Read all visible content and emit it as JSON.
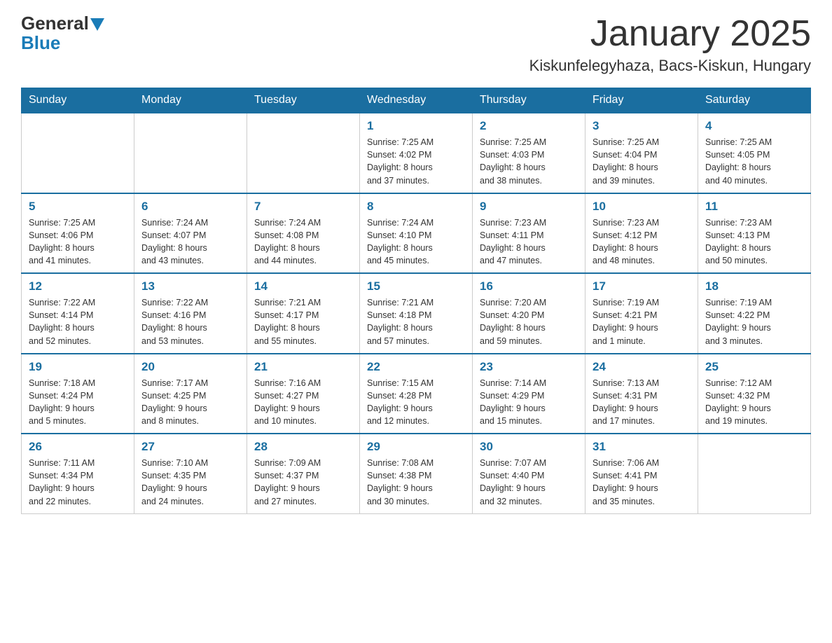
{
  "header": {
    "logo_general": "General",
    "logo_blue": "Blue",
    "month_title": "January 2025",
    "location": "Kiskunfelegyhaza, Bacs-Kiskun, Hungary"
  },
  "weekdays": [
    "Sunday",
    "Monday",
    "Tuesday",
    "Wednesday",
    "Thursday",
    "Friday",
    "Saturday"
  ],
  "weeks": [
    {
      "days": [
        {
          "num": "",
          "info": ""
        },
        {
          "num": "",
          "info": ""
        },
        {
          "num": "",
          "info": ""
        },
        {
          "num": "1",
          "info": "Sunrise: 7:25 AM\nSunset: 4:02 PM\nDaylight: 8 hours\nand 37 minutes."
        },
        {
          "num": "2",
          "info": "Sunrise: 7:25 AM\nSunset: 4:03 PM\nDaylight: 8 hours\nand 38 minutes."
        },
        {
          "num": "3",
          "info": "Sunrise: 7:25 AM\nSunset: 4:04 PM\nDaylight: 8 hours\nand 39 minutes."
        },
        {
          "num": "4",
          "info": "Sunrise: 7:25 AM\nSunset: 4:05 PM\nDaylight: 8 hours\nand 40 minutes."
        }
      ]
    },
    {
      "days": [
        {
          "num": "5",
          "info": "Sunrise: 7:25 AM\nSunset: 4:06 PM\nDaylight: 8 hours\nand 41 minutes."
        },
        {
          "num": "6",
          "info": "Sunrise: 7:24 AM\nSunset: 4:07 PM\nDaylight: 8 hours\nand 43 minutes."
        },
        {
          "num": "7",
          "info": "Sunrise: 7:24 AM\nSunset: 4:08 PM\nDaylight: 8 hours\nand 44 minutes."
        },
        {
          "num": "8",
          "info": "Sunrise: 7:24 AM\nSunset: 4:10 PM\nDaylight: 8 hours\nand 45 minutes."
        },
        {
          "num": "9",
          "info": "Sunrise: 7:23 AM\nSunset: 4:11 PM\nDaylight: 8 hours\nand 47 minutes."
        },
        {
          "num": "10",
          "info": "Sunrise: 7:23 AM\nSunset: 4:12 PM\nDaylight: 8 hours\nand 48 minutes."
        },
        {
          "num": "11",
          "info": "Sunrise: 7:23 AM\nSunset: 4:13 PM\nDaylight: 8 hours\nand 50 minutes."
        }
      ]
    },
    {
      "days": [
        {
          "num": "12",
          "info": "Sunrise: 7:22 AM\nSunset: 4:14 PM\nDaylight: 8 hours\nand 52 minutes."
        },
        {
          "num": "13",
          "info": "Sunrise: 7:22 AM\nSunset: 4:16 PM\nDaylight: 8 hours\nand 53 minutes."
        },
        {
          "num": "14",
          "info": "Sunrise: 7:21 AM\nSunset: 4:17 PM\nDaylight: 8 hours\nand 55 minutes."
        },
        {
          "num": "15",
          "info": "Sunrise: 7:21 AM\nSunset: 4:18 PM\nDaylight: 8 hours\nand 57 minutes."
        },
        {
          "num": "16",
          "info": "Sunrise: 7:20 AM\nSunset: 4:20 PM\nDaylight: 8 hours\nand 59 minutes."
        },
        {
          "num": "17",
          "info": "Sunrise: 7:19 AM\nSunset: 4:21 PM\nDaylight: 9 hours\nand 1 minute."
        },
        {
          "num": "18",
          "info": "Sunrise: 7:19 AM\nSunset: 4:22 PM\nDaylight: 9 hours\nand 3 minutes."
        }
      ]
    },
    {
      "days": [
        {
          "num": "19",
          "info": "Sunrise: 7:18 AM\nSunset: 4:24 PM\nDaylight: 9 hours\nand 5 minutes."
        },
        {
          "num": "20",
          "info": "Sunrise: 7:17 AM\nSunset: 4:25 PM\nDaylight: 9 hours\nand 8 minutes."
        },
        {
          "num": "21",
          "info": "Sunrise: 7:16 AM\nSunset: 4:27 PM\nDaylight: 9 hours\nand 10 minutes."
        },
        {
          "num": "22",
          "info": "Sunrise: 7:15 AM\nSunset: 4:28 PM\nDaylight: 9 hours\nand 12 minutes."
        },
        {
          "num": "23",
          "info": "Sunrise: 7:14 AM\nSunset: 4:29 PM\nDaylight: 9 hours\nand 15 minutes."
        },
        {
          "num": "24",
          "info": "Sunrise: 7:13 AM\nSunset: 4:31 PM\nDaylight: 9 hours\nand 17 minutes."
        },
        {
          "num": "25",
          "info": "Sunrise: 7:12 AM\nSunset: 4:32 PM\nDaylight: 9 hours\nand 19 minutes."
        }
      ]
    },
    {
      "days": [
        {
          "num": "26",
          "info": "Sunrise: 7:11 AM\nSunset: 4:34 PM\nDaylight: 9 hours\nand 22 minutes."
        },
        {
          "num": "27",
          "info": "Sunrise: 7:10 AM\nSunset: 4:35 PM\nDaylight: 9 hours\nand 24 minutes."
        },
        {
          "num": "28",
          "info": "Sunrise: 7:09 AM\nSunset: 4:37 PM\nDaylight: 9 hours\nand 27 minutes."
        },
        {
          "num": "29",
          "info": "Sunrise: 7:08 AM\nSunset: 4:38 PM\nDaylight: 9 hours\nand 30 minutes."
        },
        {
          "num": "30",
          "info": "Sunrise: 7:07 AM\nSunset: 4:40 PM\nDaylight: 9 hours\nand 32 minutes."
        },
        {
          "num": "31",
          "info": "Sunrise: 7:06 AM\nSunset: 4:41 PM\nDaylight: 9 hours\nand 35 minutes."
        },
        {
          "num": "",
          "info": ""
        }
      ]
    }
  ]
}
